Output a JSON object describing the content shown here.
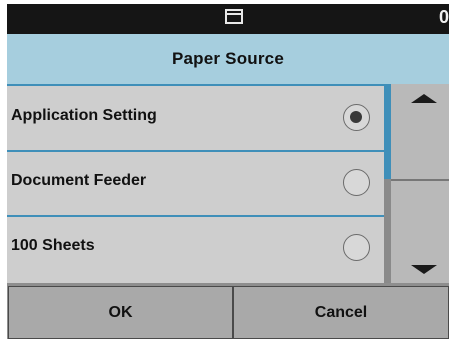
{
  "status_bar": {
    "icon": "paper-tray-icon",
    "right_text": "0"
  },
  "title": "Paper Source",
  "options": [
    {
      "label": "Application Setting",
      "selected": true
    },
    {
      "label": "Document Feeder",
      "selected": false
    },
    {
      "label": "100 Sheets",
      "selected": false
    }
  ],
  "scroll": {
    "up_icon": "triangle-up-icon",
    "down_icon": "triangle-down-icon"
  },
  "footer": {
    "ok_label": "OK",
    "cancel_label": "Cancel"
  },
  "colors": {
    "status_bar": "#151515",
    "title_bar": "#a6cede",
    "accent": "#3f8fb9",
    "list_bg": "#cecece",
    "button_bg": "#a9a9a9"
  }
}
